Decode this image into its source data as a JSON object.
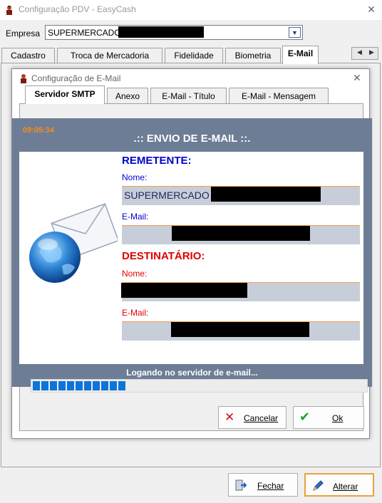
{
  "window": {
    "title": "Configuração PDV - EasyCash",
    "close_glyph": "✕"
  },
  "empresa": {
    "label": "Empresa",
    "value": "SUPERMERCADO"
  },
  "main_tabs": [
    {
      "label": "Cadastro"
    },
    {
      "label": "Troca de Mercadoria"
    },
    {
      "label": "Fidelidade"
    },
    {
      "label": "Biometria"
    },
    {
      "label": "E-Mail",
      "active": true
    }
  ],
  "dialog": {
    "title": "Configuração de E-Mail",
    "close_glyph": "✕",
    "tabs": [
      {
        "label": "Servidor SMTP",
        "active": true
      },
      {
        "label": "Anexo"
      },
      {
        "label": "E-Mail - Título"
      },
      {
        "label": "E-Mail - Mensagem"
      }
    ],
    "cancel_label": "Cancelar",
    "ok_label": "Ok"
  },
  "progress_dialog": {
    "time": "09:05:34",
    "heading": ".:: ENVIO DE E-MAIL ::.",
    "sender_heading": "REMETENTE:",
    "sender_name_label": "Nome:",
    "sender_name_value": "SUPERMERCADO",
    "sender_email_label": "E-Mail:",
    "recipient_heading": "DESTINATÁRIO:",
    "recipient_name_label": "Nome:",
    "recipient_email_label": "E-Mail:",
    "status": "Logando no servidor de e-mail...",
    "progress_fraction": 0.28,
    "colors": {
      "sender": "#0000cc",
      "recipient": "#e00000",
      "progress": "#0d74d8",
      "time": "#f68c1f"
    }
  },
  "footer": {
    "close_label": "Fechar",
    "save_label": "Alterar"
  }
}
